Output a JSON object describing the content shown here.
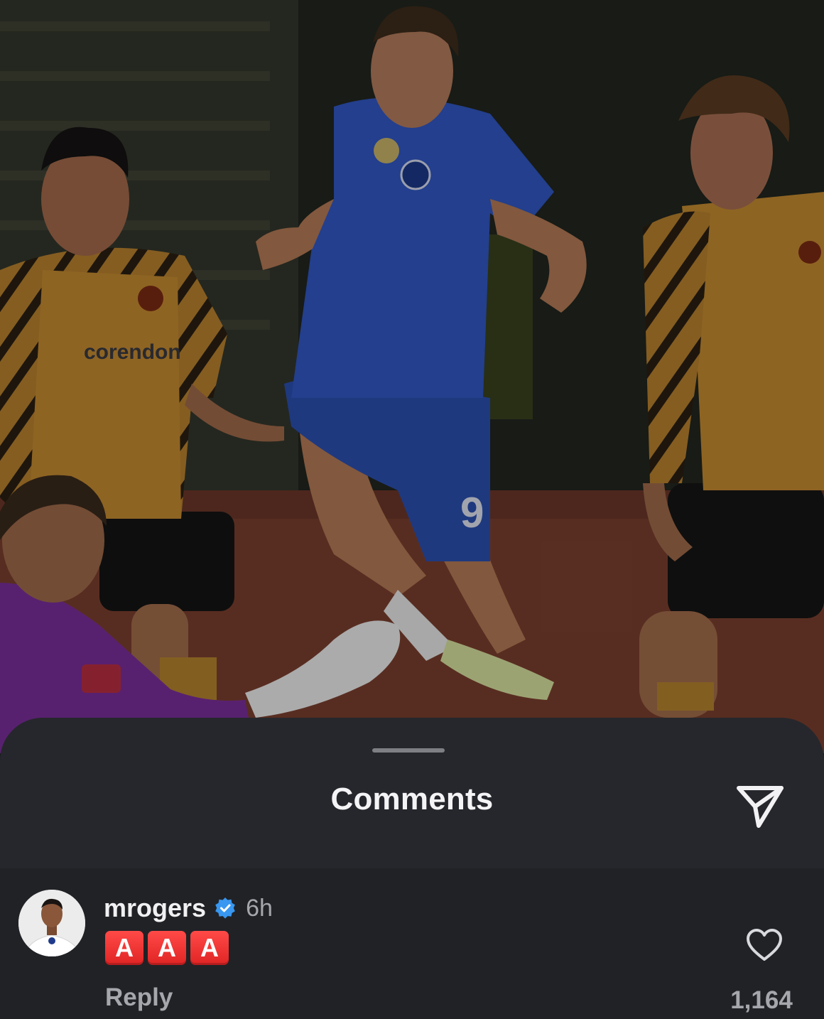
{
  "sheet": {
    "title": "Comments",
    "share_icon": "paper-plane-icon"
  },
  "comment": {
    "username": "mrogers",
    "verified": true,
    "verified_icon": "verified-badge-icon",
    "timestamp": "6h",
    "emojis": [
      "A",
      "A",
      "A"
    ],
    "reply_label": "Reply",
    "like_icon": "heart-outline-icon",
    "like_count": "1,164"
  },
  "photo": {
    "jersey_number": "9",
    "sponsor": "corendon"
  },
  "colors": {
    "sheet_background": "#26272c",
    "text_primary": "#f1f1f3",
    "text_secondary": "#a5a7ad",
    "verified_blue": "#3897f0",
    "emoji_red": "#e02424"
  }
}
